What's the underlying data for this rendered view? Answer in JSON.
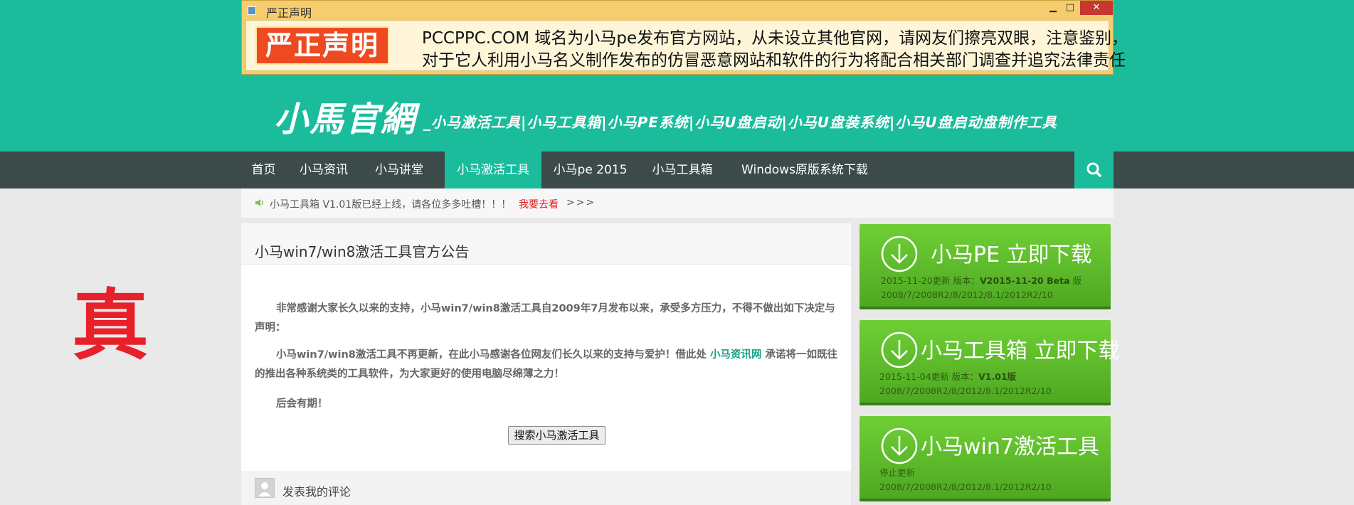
{
  "popup": {
    "title": "严正声明",
    "minimize": "▁",
    "maximize": "□",
    "close": "✕",
    "badge": "严正声明",
    "line1": "PCCPPC.COM 域名为小马pe发布官方网站，从未设立其他官网，请网友们擦亮双眼，注意鉴别，",
    "line2": "对于它人利用小马名义制作发布的仿冒恶意网站和软件的行为将配合相关部门调查并追究法律责任"
  },
  "logo": {
    "main": "小馬官網",
    "sub": "_小马激活工具|小马工具箱|小马PE系统|小马U盘启动|小马U盘装系统|小马U盘启动盘制作工具"
  },
  "nav": {
    "items": [
      "首页",
      "小马资讯",
      "小马讲堂",
      "小马激活工具",
      "小马pe 2015",
      "小马工具箱",
      "Windows原版系统下载"
    ],
    "active_index": 3
  },
  "ticker": {
    "text": "小马工具箱 V1.01版已经上线，请各位多多吐槽！！！",
    "link": "我要去看",
    "more": ">>>"
  },
  "stamp": "真",
  "article": {
    "title": "小马win7/win8激活工具官方公告",
    "p1": "非常感谢大家长久以来的支持，小马win7/win8激活工具自2009年7月发布以来，承受多方压力，不得不做出如下决定与声明：",
    "p2_before": "小马win7/win8激活工具不再更新，在此小马感谢各位网友们长久以来的支持与爱护！借此处 ",
    "p2_link": "小马资讯网",
    "p2_after": " 承诺将一如既往的推出各种系统类的工具软件，为大家更好的使用电脑尽绵薄之力！",
    "p3": "后会有期！",
    "search_button": "搜索小马激活工具",
    "comment_label": "发表我的评论"
  },
  "downloads": [
    {
      "title": "小马PE 立即下载",
      "meta_prefix": "2015-11-20更新 版本：",
      "version": "V2015-11-20 Beta",
      "meta_suffix": " 版",
      "systems": "2008/7/2008R2/8/2012/8.1/2012R2/10"
    },
    {
      "title": "小马工具箱 立即下载",
      "meta_prefix": "2015-11-04更新 版本：",
      "version": "V1.01版",
      "meta_suffix": "",
      "systems": "2008/7/2008R2/8/2012/8.1/2012R2/10"
    },
    {
      "title": "小马win7激活工具",
      "meta_prefix": "停止更新",
      "version": "",
      "meta_suffix": "",
      "systems": "2008/7/2008R2/8/2012/8.1/2012R2/10"
    }
  ],
  "colors": {
    "teal": "#1abc9c",
    "nav_dark": "#3c4a49",
    "download_green": "#5bbd2a",
    "stamp_red": "#e8202a",
    "badge_red": "#ee4a21"
  }
}
